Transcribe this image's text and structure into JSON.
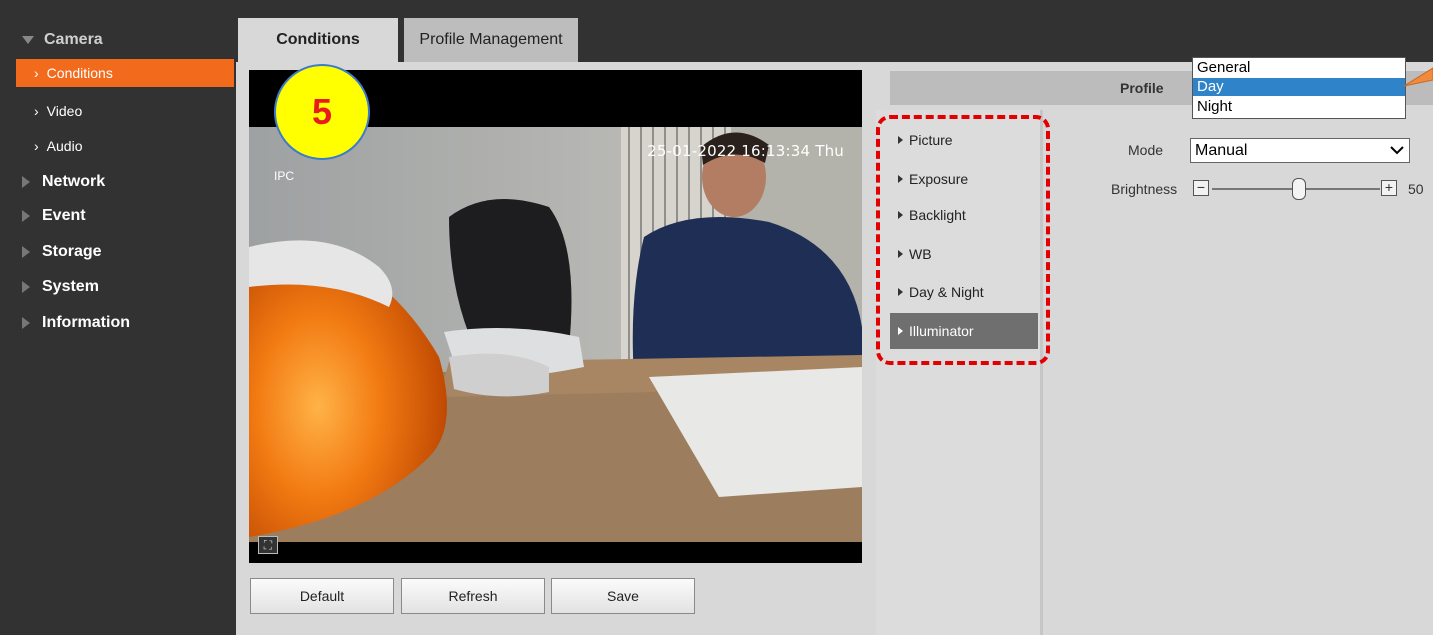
{
  "sidebar": {
    "camera": "Camera",
    "sub_items": [
      {
        "label": "Conditions"
      },
      {
        "label": "Video"
      },
      {
        "label": "Audio"
      }
    ],
    "categories": [
      {
        "label": "Network"
      },
      {
        "label": "Event"
      },
      {
        "label": "Storage"
      },
      {
        "label": "System"
      },
      {
        "label": "Information"
      }
    ]
  },
  "tabs": [
    {
      "label": "Conditions"
    },
    {
      "label": "Profile Management"
    }
  ],
  "video": {
    "timestamp": "25-01-2022 16:13:34 Thu",
    "channel_label": "IPC",
    "fullscreen_icon": "fullscreen-icon"
  },
  "badge": "5",
  "buttons": {
    "default": "Default",
    "refresh": "Refresh",
    "save": "Save"
  },
  "menu": [
    {
      "label": "Picture"
    },
    {
      "label": "Exposure"
    },
    {
      "label": "Backlight"
    },
    {
      "label": "WB"
    },
    {
      "label": "Day & Night"
    },
    {
      "label": "Illuminator"
    }
  ],
  "profile": {
    "label": "Profile",
    "options": [
      "General",
      "Day",
      "Night"
    ],
    "selected": "Day"
  },
  "mode": {
    "label": "Mode",
    "value": "Manual"
  },
  "brightness": {
    "label": "Brightness",
    "value": "50"
  },
  "colors": {
    "accent": "#f26b1d",
    "highlight": "#e30000",
    "select_blue": "#2f83c8"
  }
}
